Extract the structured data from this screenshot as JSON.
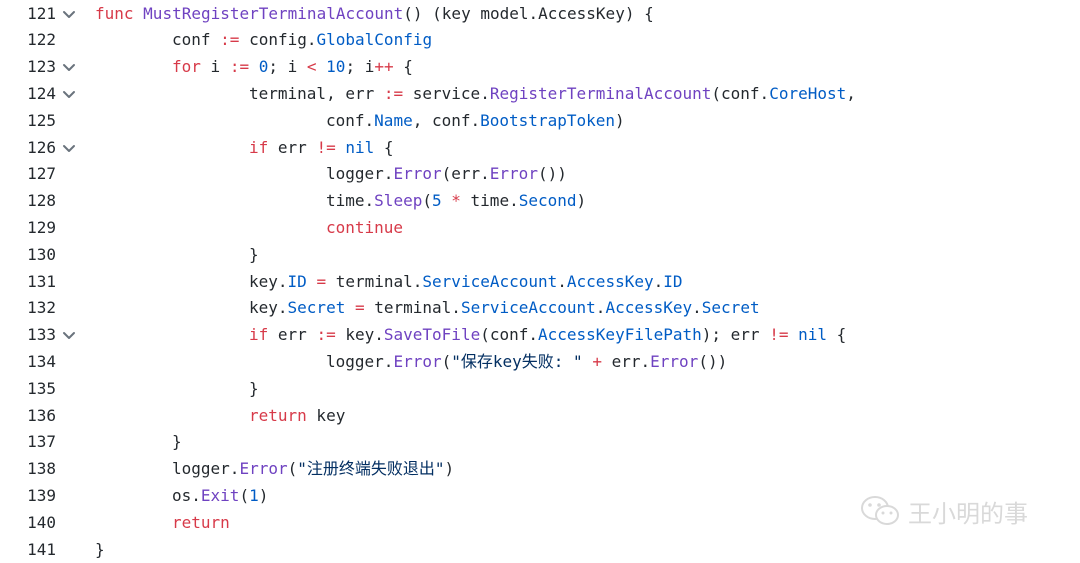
{
  "editor": {
    "lines": [
      {
        "number": "121",
        "fold": true,
        "indent": 0,
        "tokens": [
          {
            "t": "kw",
            "v": "func"
          },
          {
            "t": "pl",
            "v": " "
          },
          {
            "t": "fn",
            "v": "MustRegisterTerminalAccount"
          },
          {
            "t": "pl",
            "v": "() (key model.AccessKey) {"
          }
        ]
      },
      {
        "number": "122",
        "fold": false,
        "indent": 1,
        "tokens": [
          {
            "t": "pl",
            "v": "conf "
          },
          {
            "t": "kw",
            "v": ":="
          },
          {
            "t": "pl",
            "v": " config."
          },
          {
            "t": "fld",
            "v": "GlobalConfig"
          }
        ]
      },
      {
        "number": "123",
        "fold": true,
        "indent": 1,
        "tokens": [
          {
            "t": "kw",
            "v": "for"
          },
          {
            "t": "pl",
            "v": " i "
          },
          {
            "t": "kw",
            "v": ":="
          },
          {
            "t": "pl",
            "v": " "
          },
          {
            "t": "num",
            "v": "0"
          },
          {
            "t": "pl",
            "v": "; i "
          },
          {
            "t": "kw",
            "v": "<"
          },
          {
            "t": "pl",
            "v": " "
          },
          {
            "t": "num",
            "v": "10"
          },
          {
            "t": "pl",
            "v": "; i"
          },
          {
            "t": "kw",
            "v": "++"
          },
          {
            "t": "pl",
            "v": " {"
          }
        ]
      },
      {
        "number": "124",
        "fold": true,
        "indent": 2,
        "tokens": [
          {
            "t": "pl",
            "v": "terminal, err "
          },
          {
            "t": "kw",
            "v": ":="
          },
          {
            "t": "pl",
            "v": " service."
          },
          {
            "t": "fn",
            "v": "RegisterTerminalAccount"
          },
          {
            "t": "pl",
            "v": "(conf."
          },
          {
            "t": "fld",
            "v": "CoreHost"
          },
          {
            "t": "pl",
            "v": ","
          }
        ]
      },
      {
        "number": "125",
        "fold": false,
        "indent": 3,
        "tokens": [
          {
            "t": "pl",
            "v": "conf."
          },
          {
            "t": "fld",
            "v": "Name"
          },
          {
            "t": "pl",
            "v": ", conf."
          },
          {
            "t": "fld",
            "v": "BootstrapToken"
          },
          {
            "t": "pl",
            "v": ")"
          }
        ]
      },
      {
        "number": "126",
        "fold": true,
        "indent": 2,
        "tokens": [
          {
            "t": "kw",
            "v": "if"
          },
          {
            "t": "pl",
            "v": " err "
          },
          {
            "t": "kw",
            "v": "!="
          },
          {
            "t": "pl",
            "v": " "
          },
          {
            "t": "num",
            "v": "nil"
          },
          {
            "t": "pl",
            "v": " {"
          }
        ]
      },
      {
        "number": "127",
        "fold": false,
        "indent": 3,
        "tokens": [
          {
            "t": "pl",
            "v": "logger."
          },
          {
            "t": "fn",
            "v": "Error"
          },
          {
            "t": "pl",
            "v": "(err."
          },
          {
            "t": "fn",
            "v": "Error"
          },
          {
            "t": "pl",
            "v": "())"
          }
        ]
      },
      {
        "number": "128",
        "fold": false,
        "indent": 3,
        "tokens": [
          {
            "t": "pl",
            "v": "time."
          },
          {
            "t": "fn",
            "v": "Sleep"
          },
          {
            "t": "pl",
            "v": "("
          },
          {
            "t": "num",
            "v": "5"
          },
          {
            "t": "pl",
            "v": " "
          },
          {
            "t": "kw",
            "v": "*"
          },
          {
            "t": "pl",
            "v": " time."
          },
          {
            "t": "fld",
            "v": "Second"
          },
          {
            "t": "pl",
            "v": ")"
          }
        ]
      },
      {
        "number": "129",
        "fold": false,
        "indent": 3,
        "tokens": [
          {
            "t": "kw",
            "v": "continue"
          }
        ]
      },
      {
        "number": "130",
        "fold": false,
        "indent": 2,
        "tokens": [
          {
            "t": "pl",
            "v": "}"
          }
        ]
      },
      {
        "number": "131",
        "fold": false,
        "indent": 2,
        "tokens": [
          {
            "t": "pl",
            "v": "key."
          },
          {
            "t": "fld",
            "v": "ID"
          },
          {
            "t": "pl",
            "v": " "
          },
          {
            "t": "kw",
            "v": "="
          },
          {
            "t": "pl",
            "v": " terminal."
          },
          {
            "t": "fld",
            "v": "ServiceAccount"
          },
          {
            "t": "pl",
            "v": "."
          },
          {
            "t": "fld",
            "v": "AccessKey"
          },
          {
            "t": "pl",
            "v": "."
          },
          {
            "t": "fld",
            "v": "ID"
          }
        ]
      },
      {
        "number": "132",
        "fold": false,
        "indent": 2,
        "tokens": [
          {
            "t": "pl",
            "v": "key."
          },
          {
            "t": "fld",
            "v": "Secret"
          },
          {
            "t": "pl",
            "v": " "
          },
          {
            "t": "kw",
            "v": "="
          },
          {
            "t": "pl",
            "v": " terminal."
          },
          {
            "t": "fld",
            "v": "ServiceAccount"
          },
          {
            "t": "pl",
            "v": "."
          },
          {
            "t": "fld",
            "v": "AccessKey"
          },
          {
            "t": "pl",
            "v": "."
          },
          {
            "t": "fld",
            "v": "Secret"
          }
        ]
      },
      {
        "number": "133",
        "fold": true,
        "indent": 2,
        "tokens": [
          {
            "t": "kw",
            "v": "if"
          },
          {
            "t": "pl",
            "v": " err "
          },
          {
            "t": "kw",
            "v": ":="
          },
          {
            "t": "pl",
            "v": " key."
          },
          {
            "t": "fn",
            "v": "SaveToFile"
          },
          {
            "t": "pl",
            "v": "(conf."
          },
          {
            "t": "fld",
            "v": "AccessKeyFilePath"
          },
          {
            "t": "pl",
            "v": "); err "
          },
          {
            "t": "kw",
            "v": "!="
          },
          {
            "t": "pl",
            "v": " "
          },
          {
            "t": "num",
            "v": "nil"
          },
          {
            "t": "pl",
            "v": " {"
          }
        ]
      },
      {
        "number": "134",
        "fold": false,
        "indent": 3,
        "tokens": [
          {
            "t": "pl",
            "v": "logger."
          },
          {
            "t": "fn",
            "v": "Error"
          },
          {
            "t": "pl",
            "v": "("
          },
          {
            "t": "str",
            "v": "\"保存key失败: \""
          },
          {
            "t": "pl",
            "v": " "
          },
          {
            "t": "kw",
            "v": "+"
          },
          {
            "t": "pl",
            "v": " err."
          },
          {
            "t": "fn",
            "v": "Error"
          },
          {
            "t": "pl",
            "v": "())"
          }
        ]
      },
      {
        "number": "135",
        "fold": false,
        "indent": 2,
        "tokens": [
          {
            "t": "pl",
            "v": "}"
          }
        ]
      },
      {
        "number": "136",
        "fold": false,
        "indent": 2,
        "tokens": [
          {
            "t": "kw",
            "v": "return"
          },
          {
            "t": "pl",
            "v": " key"
          }
        ]
      },
      {
        "number": "137",
        "fold": false,
        "indent": 1,
        "tokens": [
          {
            "t": "pl",
            "v": "}"
          }
        ]
      },
      {
        "number": "138",
        "fold": false,
        "indent": 1,
        "tokens": [
          {
            "t": "pl",
            "v": "logger."
          },
          {
            "t": "fn",
            "v": "Error"
          },
          {
            "t": "pl",
            "v": "("
          },
          {
            "t": "str",
            "v": "\"注册终端失败退出\""
          },
          {
            "t": "pl",
            "v": ")"
          }
        ]
      },
      {
        "number": "139",
        "fold": false,
        "indent": 1,
        "tokens": [
          {
            "t": "pl",
            "v": "os."
          },
          {
            "t": "fn",
            "v": "Exit"
          },
          {
            "t": "pl",
            "v": "("
          },
          {
            "t": "num",
            "v": "1"
          },
          {
            "t": "pl",
            "v": ")"
          }
        ]
      },
      {
        "number": "140",
        "fold": false,
        "indent": 1,
        "tokens": [
          {
            "t": "kw",
            "v": "return"
          }
        ]
      },
      {
        "number": "141",
        "fold": false,
        "indent": 0,
        "tokens": [
          {
            "t": "pl",
            "v": "}"
          }
        ]
      }
    ]
  },
  "watermark": {
    "icon": "wechat-icon",
    "text": "王小明的事"
  },
  "colors": {
    "keyword": "#d73a49",
    "function": "#6f42c1",
    "field": "#005cc5",
    "string": "#032f62",
    "plain": "#24292e",
    "fold_chevron": "#6a737d",
    "watermark": "#d9d9d9"
  }
}
